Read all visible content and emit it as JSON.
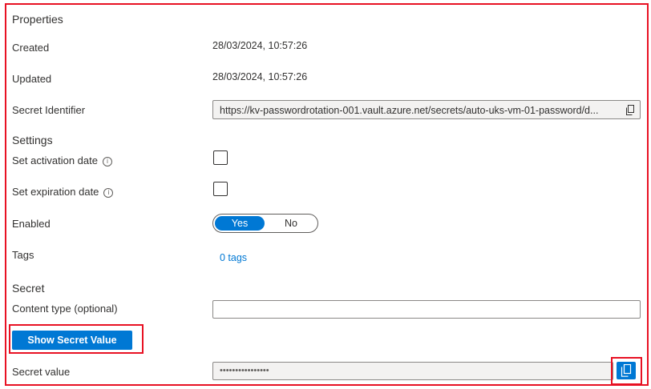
{
  "properties": {
    "section_title": "Properties",
    "created_label": "Created",
    "created_value": "28/03/2024, 10:57:26",
    "updated_label": "Updated",
    "updated_value": "28/03/2024, 10:57:26",
    "identifier_label": "Secret Identifier",
    "identifier_value": "https://kv-passwordrotation-001.vault.azure.net/secrets/auto-uks-vm-01-password/d..."
  },
  "settings": {
    "section_title": "Settings",
    "activation_label": "Set activation date",
    "activation_checked": false,
    "expiration_label": "Set expiration date",
    "expiration_checked": false,
    "enabled_label": "Enabled",
    "enabled_yes": "Yes",
    "enabled_no": "No",
    "enabled_selected": "Yes",
    "tags_label": "Tags",
    "tags_link": "0 tags"
  },
  "secret": {
    "section_title": "Secret",
    "content_type_label": "Content type (optional)",
    "content_type_value": "",
    "show_button_label": "Show Secret Value",
    "secret_value_label": "Secret value",
    "secret_value_masked": "••••••••••••••••"
  },
  "icons": {
    "info": "info-icon",
    "copy": "copy-icon"
  },
  "colors": {
    "accent": "#0078d4",
    "highlight": "#e81123"
  }
}
